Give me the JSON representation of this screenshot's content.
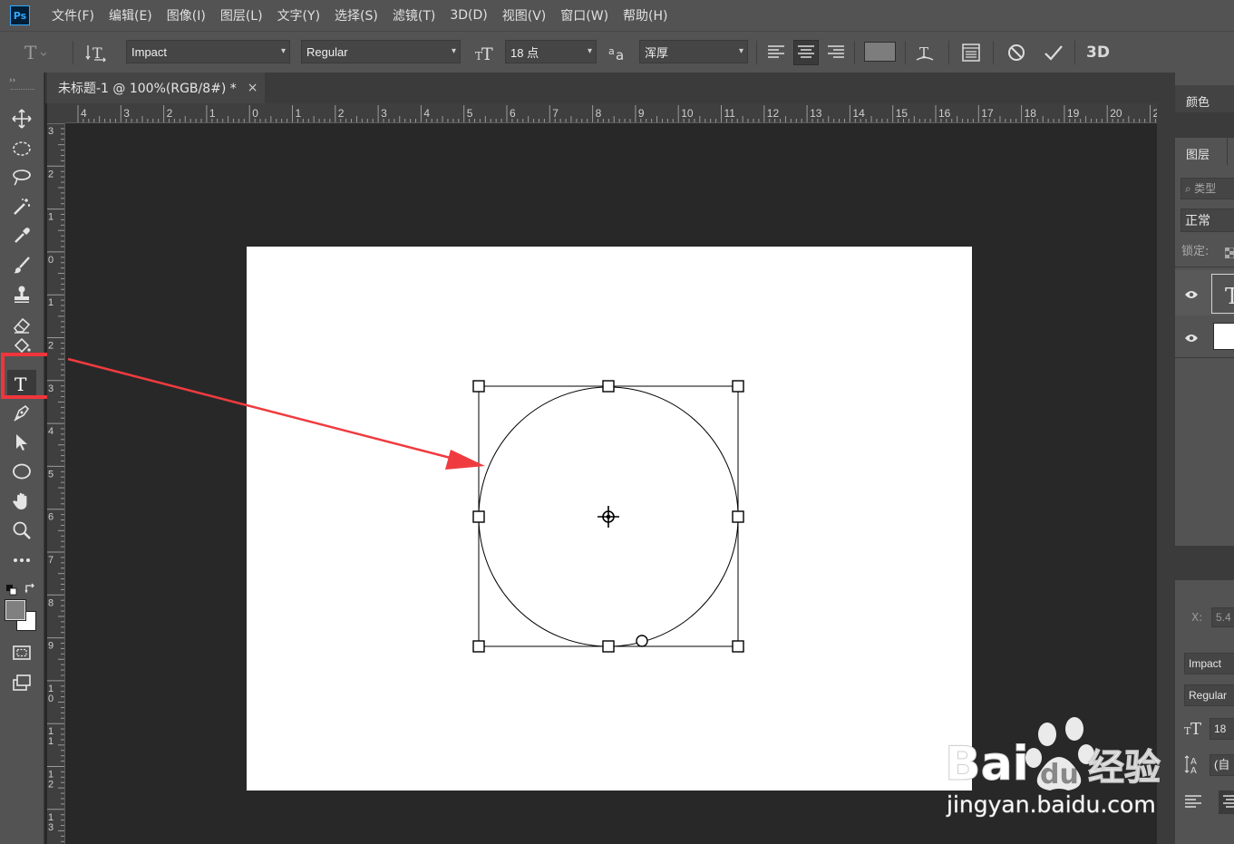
{
  "app": {
    "logo": "Ps"
  },
  "menu": [
    "文件(F)",
    "编辑(E)",
    "图像(I)",
    "图层(L)",
    "文字(Y)",
    "选择(S)",
    "滤镜(T)",
    "3D(D)",
    "视图(V)",
    "窗口(W)",
    "帮助(H)"
  ],
  "options": {
    "font_family": "Impact",
    "font_style": "Regular",
    "font_size": "18 点",
    "antialias": "浑厚",
    "threed_label": "3D",
    "color_swatch": "#7d7d7d"
  },
  "document": {
    "tab_title": "未标题-1 @ 100%(RGB/8#) *",
    "close_glyph": "×"
  },
  "rulers": {
    "h_labels": [
      "4",
      "3",
      "2",
      "1",
      "0",
      "1",
      "2",
      "3",
      "4",
      "5",
      "6",
      "7",
      "8",
      "9",
      "10",
      "11",
      "12",
      "13",
      "14",
      "15",
      "16",
      "17",
      "18",
      "19",
      "20",
      "2"
    ],
    "v_labels": [
      "3",
      "2",
      "1",
      "0",
      "1",
      "2",
      "3",
      "4",
      "5",
      "6",
      "7",
      "8",
      "9",
      "1\n0",
      "1\n1",
      "1\n2",
      "1\n3"
    ]
  },
  "panels": {
    "color_tab": "颜色",
    "layers_tab": "图层",
    "search_placeholder": "类型",
    "blend_mode": "正常",
    "lock_label": "锁定:",
    "props_x_label": "X:",
    "props_x_value": "5.4",
    "props_font": "Impact",
    "props_style": "Regular",
    "props_size": "18",
    "props_leading": "(自"
  },
  "watermark": {
    "brand": "Bai",
    "brand2": "du",
    "cn": "经验",
    "url": "jingyan.baidu.com"
  },
  "colors": {
    "highlight": "#f0353b",
    "arrow": "#ef3b3f",
    "accent": "#31a8ff"
  }
}
